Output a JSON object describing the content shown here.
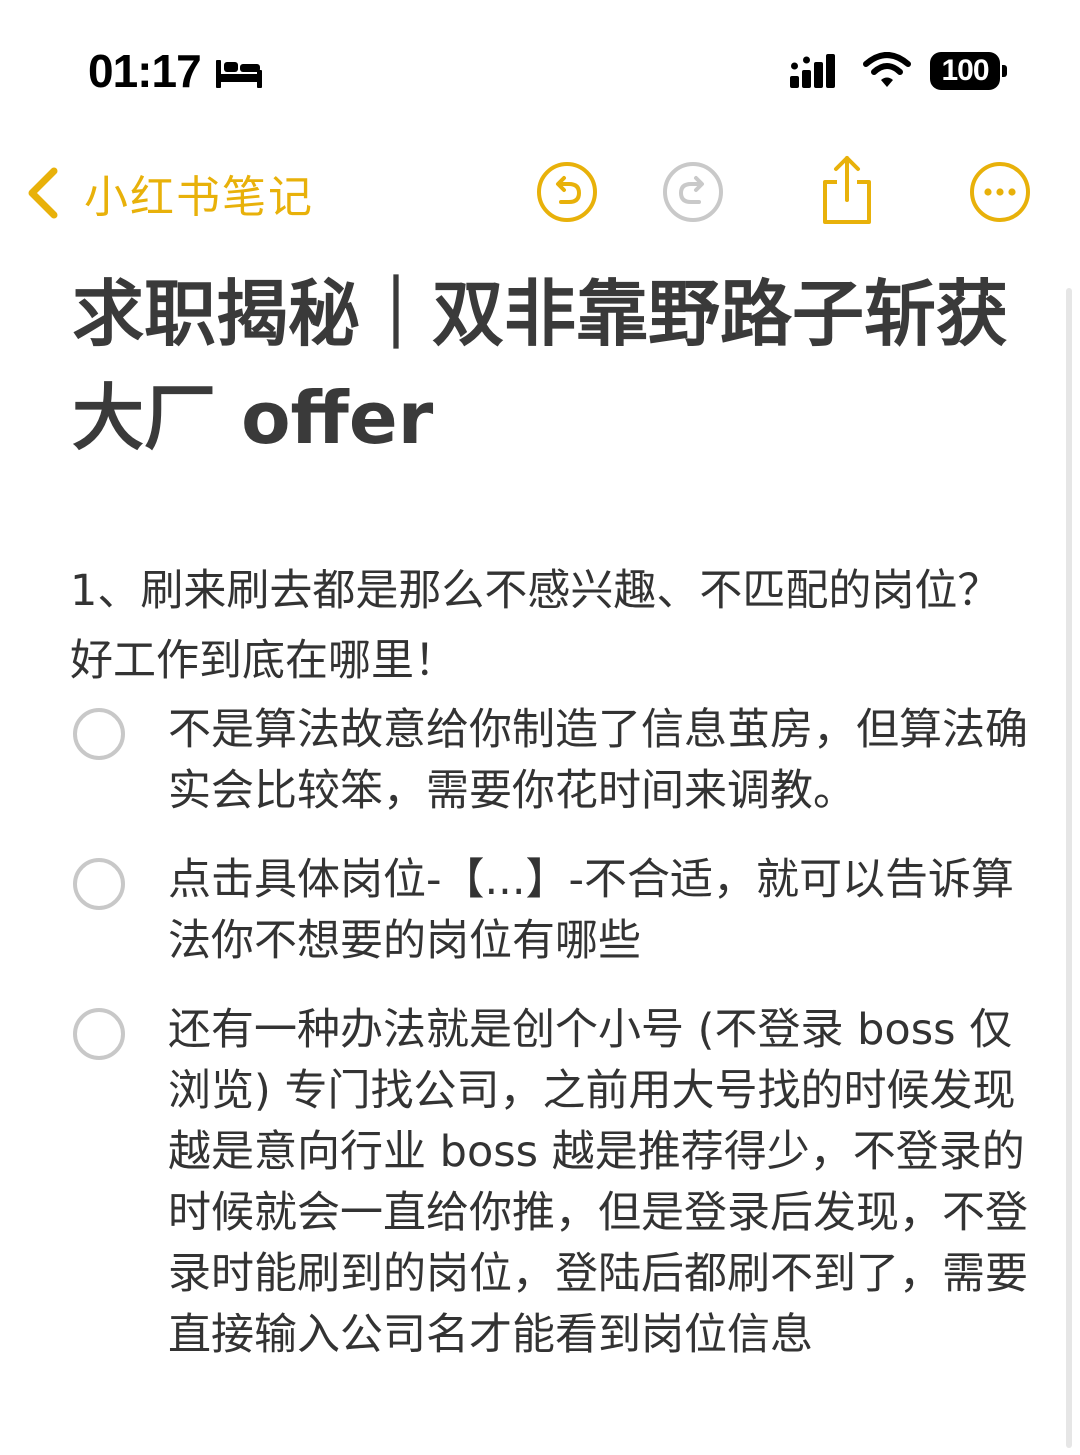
{
  "status_bar": {
    "time": "01:17",
    "battery": "100",
    "icons": [
      "bed-icon",
      "signal-icon",
      "wifi-icon",
      "battery-icon"
    ]
  },
  "nav": {
    "back_label": "小红书笔记",
    "icons": [
      "back-chevron-icon",
      "undo-icon",
      "redo-icon",
      "share-icon",
      "more-icon"
    ]
  },
  "colors": {
    "accent": "#e8b10a",
    "text": "#333333",
    "checkbox": "#c8c8c8",
    "disabled": "#c9c9c9"
  },
  "note": {
    "title": "求职揭秘｜双非靠野路子斩获大厂 offer",
    "paragraph": "1、刷来刷去都是那么不感兴趣、不匹配的岗位？好工作到底在哪里！",
    "checklist": [
      {
        "checked": false,
        "text": "不是算法故意给你制造了信息茧房，但算法确实会比较笨，需要你花时间来调教。"
      },
      {
        "checked": false,
        "text": "点击具体岗位-【...】-不合适，就可以告诉算法你不想要的岗位有哪些"
      },
      {
        "checked": false,
        "text": "还有一种办法就是创个小号 (不登录 boss 仅浏览) 专门找公司，之前用大号找的时候发现越是意向行业 boss 越是推荐得少，不登录的时候就会一直给你推，但是登录后发现，不登录时能刷到的岗位，登陆后都刷不到了，需要直接输入公司名才能看到岗位信息"
      }
    ]
  }
}
